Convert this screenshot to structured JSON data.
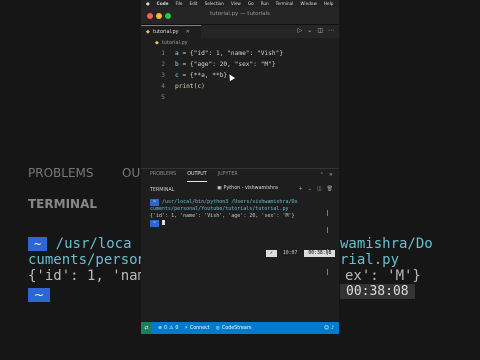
{
  "menubar": {
    "apple": "",
    "items": [
      "Code",
      "File",
      "Edit",
      "Selection",
      "View",
      "Go",
      "Run",
      "Terminal",
      "Window",
      "Help"
    ]
  },
  "window": {
    "title": "tutorial.py — tutorials"
  },
  "tab": {
    "name": "tutorial.py"
  },
  "breadcrumb": {
    "file": "tutorial.py"
  },
  "editor": {
    "lines": [
      {
        "num": "1",
        "var": "a",
        "text": " = {\"id\": 1, \"name\": \"Vish\"}"
      },
      {
        "num": "2",
        "var": "b",
        "text": " = {\"age\": 20, \"sex\": \"M\"}"
      },
      {
        "num": "3",
        "var": "c",
        "text": " = {**a, **b}"
      },
      {
        "num": "4",
        "var": "",
        "text": "print(c)"
      },
      {
        "num": "5",
        "var": "",
        "text": ""
      }
    ]
  },
  "panel": {
    "tabs": [
      "PROBLEMS",
      "OUTPUT",
      "JUPYTER"
    ],
    "active_tab": "OUTPUT",
    "terminal_label": "TERMINAL",
    "shell": "Python - vishwamishra"
  },
  "terminal": {
    "prompt": "~",
    "command_line_1": "/usr/local/bin/python3 /Users/vishwamishra/Do",
    "command_line_2": "cuments/personal/Youtube/tutorials/tutorial.py",
    "output": "{'id': 1, 'name': 'Vish', 'age': 20, 'sex': 'M'}",
    "status_check": "✓",
    "status_num": "10:07",
    "time": "00:38:08"
  },
  "statusbar": {
    "errors": "0",
    "warnings": "0",
    "connect": "Connect",
    "codestream": "CodeStream"
  },
  "background": {
    "problems": "PROBLEMS",
    "ou": "OU",
    "terminal": "TERMINAL",
    "path1": "/usr/loca",
    "path1b": "wamishra/Do",
    "path2": "cuments/person",
    "path2b": "rial.py",
    "out1": "{'id': 1, 'nam",
    "out1b": "ex': 'M'}",
    "time": "00:38:08"
  },
  "colors": {
    "accent": "#007acc",
    "prompt_bg": "#2e66d6",
    "remote": "#16825d"
  }
}
